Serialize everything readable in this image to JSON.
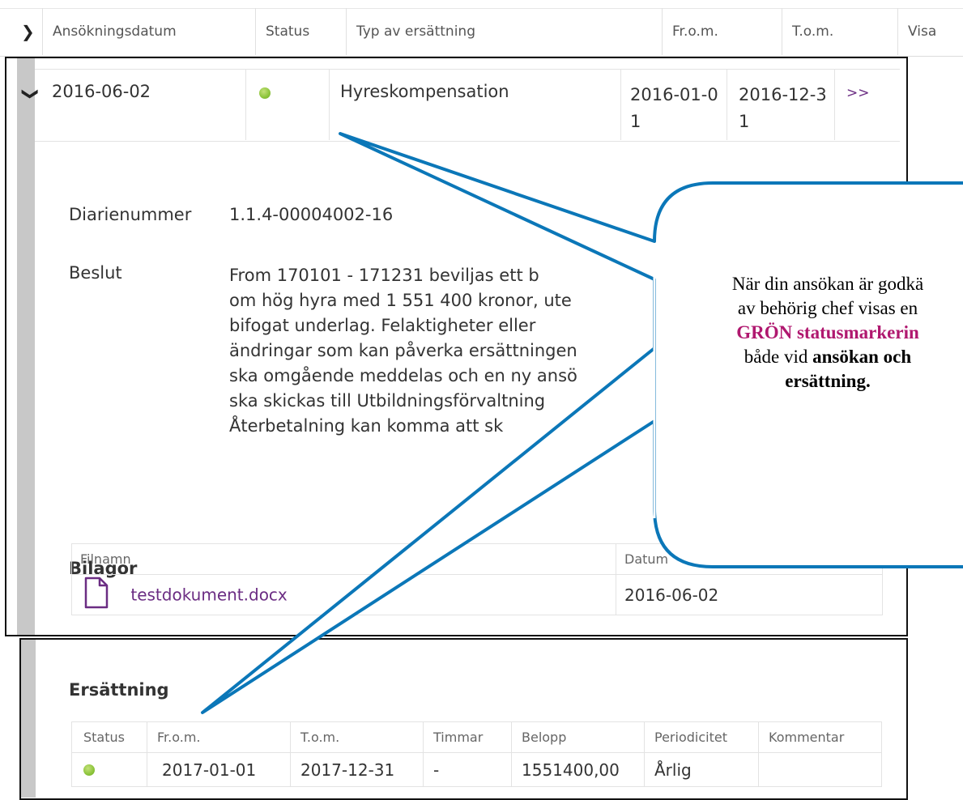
{
  "header": {
    "columns": [
      "Ansökningsdatum",
      "Status",
      "Typ av ersättning",
      "Fr.o.m.",
      "T.o.m.",
      "Visa"
    ]
  },
  "application": {
    "date": "2016-06-02",
    "type": "Hyreskompensation",
    "from": "2016-01-01",
    "to": "2016-12-31",
    "view_link": ">>",
    "status_color": "#8cc43a"
  },
  "details": {
    "diarienummer_label": "Diarienummer",
    "diarienummer": "1.1.4-00004002-16",
    "beslut_label": "Beslut",
    "beslut_lines": [
      "From 170101 - 171231 beviljas ett b",
      "om hög hyra med 1 551 400 kronor, ute",
      "bifogat underlag. Felaktigheter eller",
      "ändringar som kan påverka ersättningen",
      "ska omgående meddelas och en ny ansö",
      "ska skickas till Utbildningsförvaltning",
      "Återbetalning kan komma att sk"
    ]
  },
  "attachments": {
    "title": "Bilagor",
    "col_filename": "Filnamn",
    "col_date": "Datum",
    "file_name": "testdokument.docx",
    "file_date": "2016-06-02"
  },
  "compensation": {
    "title": "Ersättning",
    "columns": [
      "Status",
      "Fr.o.m.",
      "T.o.m.",
      "Timmar",
      "Belopp",
      "Periodicitet",
      "Kommentar"
    ],
    "row": {
      "from": "2017-01-01",
      "to": "2017-12-31",
      "hours": "-",
      "amount": "1551400,00",
      "periodicity": "Årlig",
      "comment": ""
    }
  },
  "callout": {
    "line1": "När din ansökan är godkä",
    "line2": "av behörig chef visas en",
    "line3": "GRÖN statusmarkerin",
    "line4_pre": "både vid ",
    "line4_bold": "ansökan och",
    "line5": "ersättning.",
    "border_color": "#0b77b8"
  }
}
